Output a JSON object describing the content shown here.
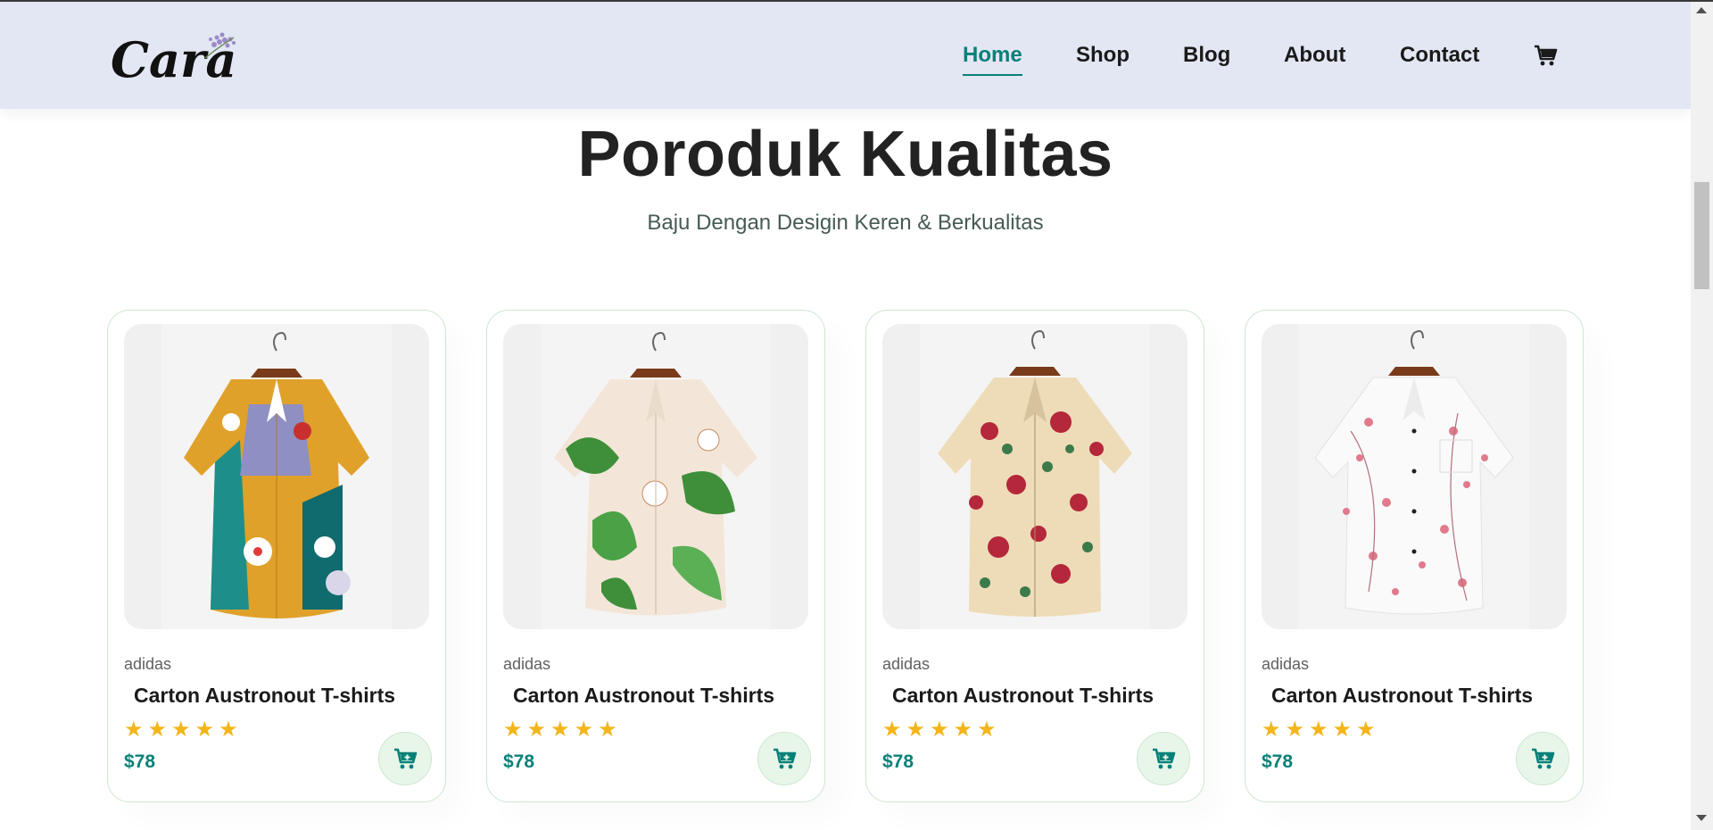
{
  "header": {
    "logo_text": "Cara",
    "nav": [
      {
        "label": "Home",
        "active": true
      },
      {
        "label": "Shop",
        "active": false
      },
      {
        "label": "Blog",
        "active": false
      },
      {
        "label": "About",
        "active": false
      },
      {
        "label": "Contact",
        "active": false
      }
    ],
    "cart_icon": "cart-icon"
  },
  "section": {
    "title": "Poroduk Kualitas",
    "subtitle": "Baju Dengan Desigin Keren & Berkualitas"
  },
  "products": [
    {
      "brand": "adidas",
      "name": "Carton Austronout T-shirts",
      "rating": 5,
      "price": "$78",
      "image": "colorful-abstract-shirt"
    },
    {
      "brand": "adidas",
      "name": "Carton Austronout T-shirts",
      "rating": 5,
      "price": "$78",
      "image": "green-leaf-floral-shirt"
    },
    {
      "brand": "adidas",
      "name": "Carton Austronout T-shirts",
      "rating": 5,
      "price": "$78",
      "image": "red-rose-floral-shirt"
    },
    {
      "brand": "adidas",
      "name": "Carton Austronout T-shirts",
      "rating": 5,
      "price": "$78",
      "image": "pink-blossom-white-shirt"
    }
  ],
  "colors": {
    "accent": "#088178",
    "header_bg": "#e3e6f3",
    "star": "#f3b519",
    "card_border": "#cce7d0"
  }
}
